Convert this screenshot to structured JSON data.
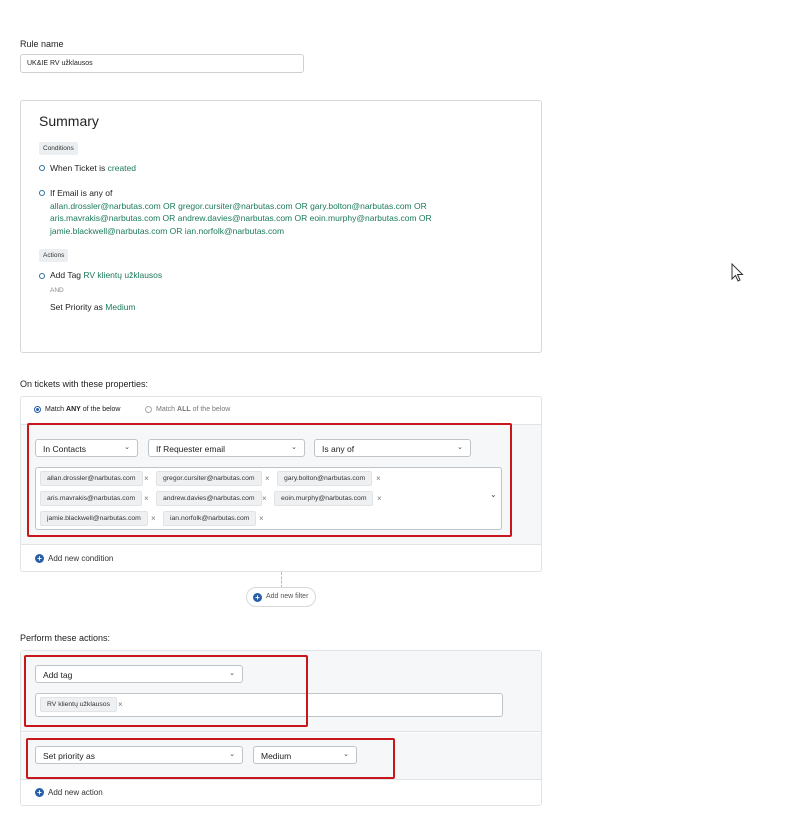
{
  "rule_name": {
    "label": "Rule name",
    "value": "UK&IE RV užklausos"
  },
  "summary": {
    "title": "Summary",
    "conditions_tag": "Conditions",
    "cond1_prefix": "When Ticket is ",
    "cond1_value": "created",
    "cond2_prefix": "If Email is any of",
    "cond2_lines": [
      "allan.drossler@narbutas.com OR gregor.cursiter@narbutas.com OR gary.bolton@narbutas.com OR",
      "aris.mavrakis@narbutas.com OR andrew.davies@narbutas.com OR eoin.murphy@narbutas.com OR",
      "jamie.blackwell@narbutas.com OR ian.norfolk@narbutas.com"
    ],
    "actions_tag": "Actions",
    "action1_prefix": "Add Tag ",
    "action1_value": "RV klientų užklausos",
    "and_text": "AND",
    "action2_prefix": "Set Priority as ",
    "action2_value": "Medium"
  },
  "conditions": {
    "heading": "On tickets with these properties:",
    "match_any_prefix": "Match ",
    "match_any_bold": "ANY",
    "match_any_suffix": " of the below",
    "match_all_prefix": "Match ",
    "match_all_bold": "ALL",
    "match_all_suffix": " of the below",
    "select_source": "In Contacts",
    "select_field": "If Requester email",
    "select_operator": "Is any of",
    "emails": [
      "allan.drossler@narbutas.com",
      "gregor.cursiter@narbutas.com",
      "gary.bolton@narbutas.com",
      "aris.mavrakis@narbutas.com",
      "andrew.davies@narbutas.com",
      "eoin.murphy@narbutas.com",
      "jamie.blackwell@narbutas.com",
      "ian.norfolk@narbutas.com"
    ],
    "add_condition": "Add new condition",
    "add_filter": "Add new filter"
  },
  "actions": {
    "heading": "Perform these actions:",
    "action1_select": "Add tag",
    "action1_tag": "RV klientų užklausos",
    "action2_select": "Set priority as",
    "action2_value": "Medium",
    "add_action": "Add new action"
  },
  "icons": {
    "dropdown": "chevron-down-icon",
    "remove": "close-icon",
    "add": "plus-circle-icon",
    "cursor": "mouse-pointer-icon"
  },
  "colors": {
    "accent": "#2a5fa8",
    "highlight": "#c8161d",
    "value_green": "#1a7a5a"
  }
}
